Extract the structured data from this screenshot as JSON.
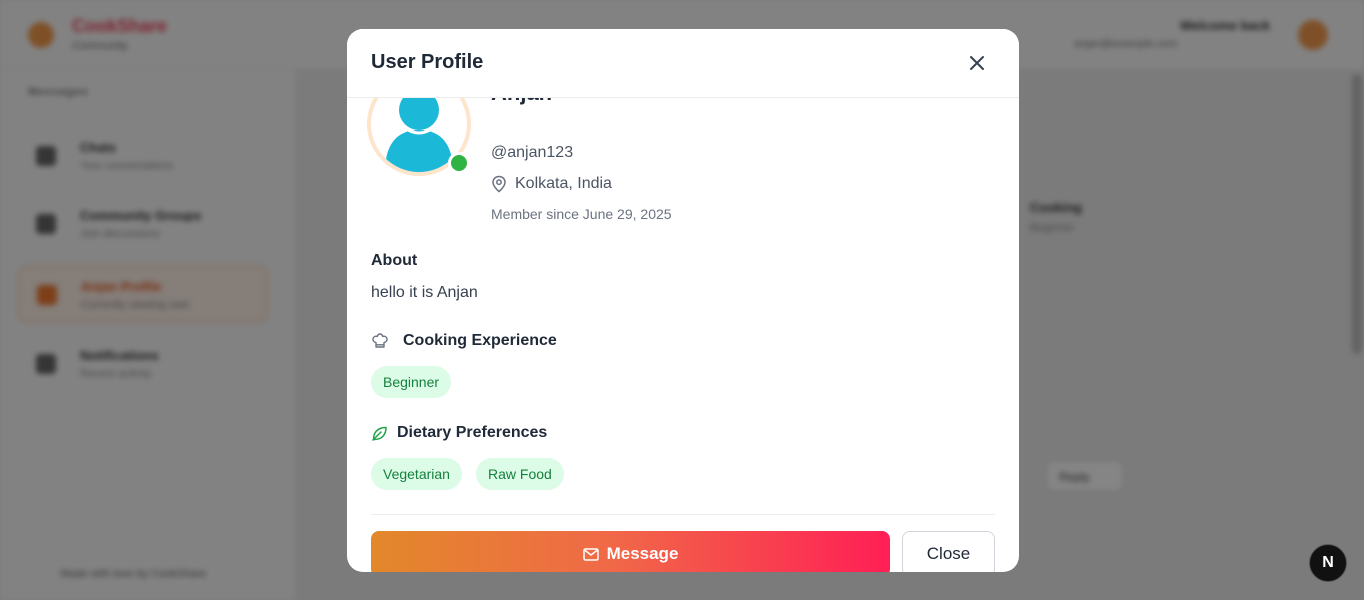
{
  "background": {
    "brand": "CookShare",
    "brand_sub": "Community",
    "section_label": "Messages",
    "sidebar_items": [
      {
        "title": "Chats",
        "sub": "Your conversations"
      },
      {
        "title": "Community Groups",
        "sub": "Join discussions"
      },
      {
        "title": "Anjan Profile",
        "sub": "Currently viewing user"
      },
      {
        "title": "Notifications",
        "sub": "Recent activity"
      }
    ],
    "user_name": "Welcome back",
    "user_email": "anjan@example.com",
    "right_title": "Cooking",
    "right_sub": "Beginner",
    "pill": "Reply",
    "footer": "Made with love by CookShare"
  },
  "modal": {
    "title": "User Profile",
    "name": "Anjan",
    "username": "@anjan123",
    "location": "Kolkata, India",
    "member_since": "Member since June 29, 2025",
    "about_heading": "About",
    "about_text": "hello it is Anjan",
    "cooking_heading": "Cooking Experience",
    "cooking_tags": [
      "Beginner"
    ],
    "dietary_heading": "Dietary Preferences",
    "dietary_tags": [
      "Vegetarian",
      "Raw Food"
    ],
    "message_button": "Message",
    "close_button": "Close"
  },
  "nextjs_badge": "N",
  "colors": {
    "accent_start": "#e2882a",
    "accent_end": "#ff1f55",
    "tag_bg": "#dcfce7",
    "tag_text": "#15803d",
    "online": "#2fb344",
    "avatar": "#1bb8d8"
  }
}
